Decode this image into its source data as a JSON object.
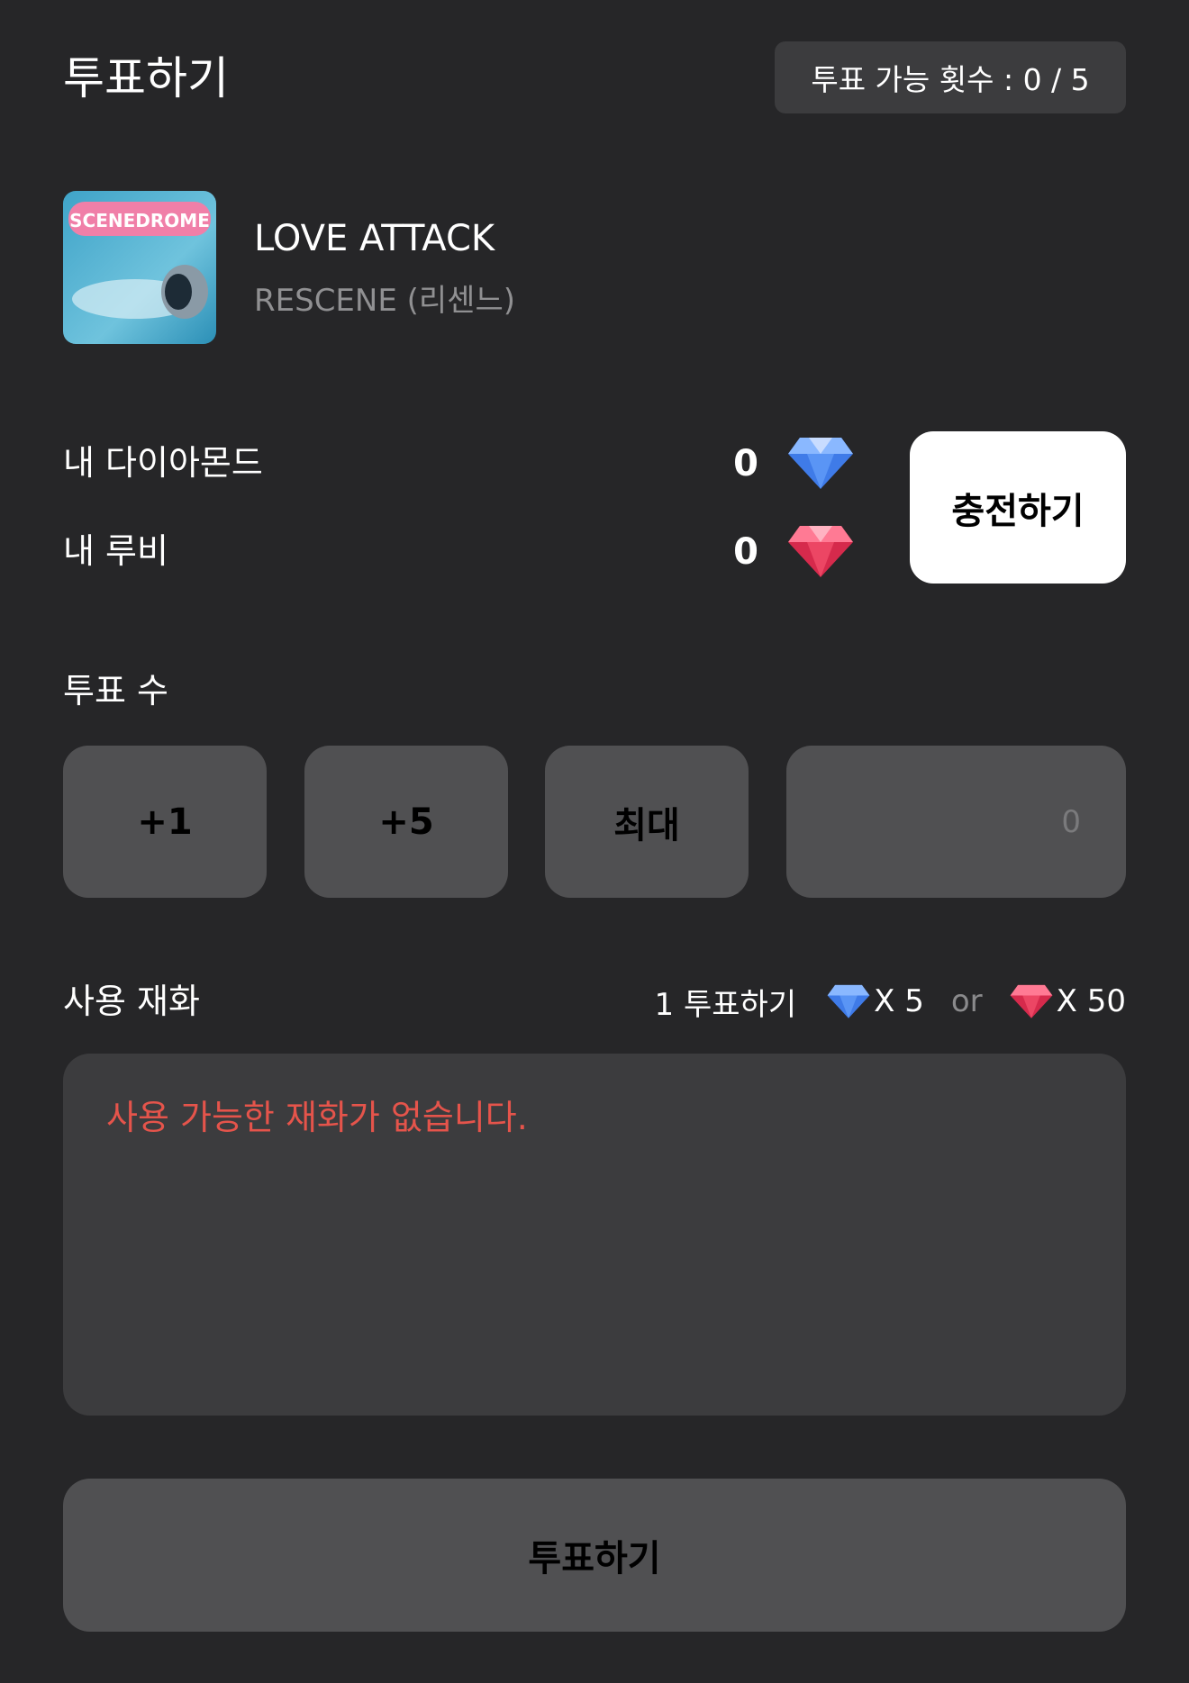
{
  "header": {
    "title": "투표하기",
    "vote_count_label": "투표 가능 횟수 : 0 / 5"
  },
  "song": {
    "title": "LOVE ATTACK",
    "artist": "RESCENE (리센느)",
    "album_cover_text": "SCENEDROME"
  },
  "wallet": {
    "diamond_label": "내 다이아몬드",
    "diamond_value": "0",
    "ruby_label": "내 루비",
    "ruby_value": "0",
    "charge_button": "충전하기"
  },
  "vote": {
    "section_label": "투표 수",
    "plus1": "+1",
    "plus5": "+5",
    "max": "최대",
    "input_placeholder": "0"
  },
  "currency": {
    "section_label": "사용 재화",
    "cost_prefix": "1 투표하기",
    "diamond_cost": "X 5",
    "or_text": "or",
    "ruby_cost": "X 50",
    "notice": "사용 가능한 재화가 없습니다."
  },
  "submit_button": "투표하기",
  "colors": {
    "background": "#262628",
    "card": "#3c3c3e",
    "button": "#505052",
    "error": "#e5544b",
    "diamond": "#4a86f0",
    "ruby": "#e8415f"
  }
}
